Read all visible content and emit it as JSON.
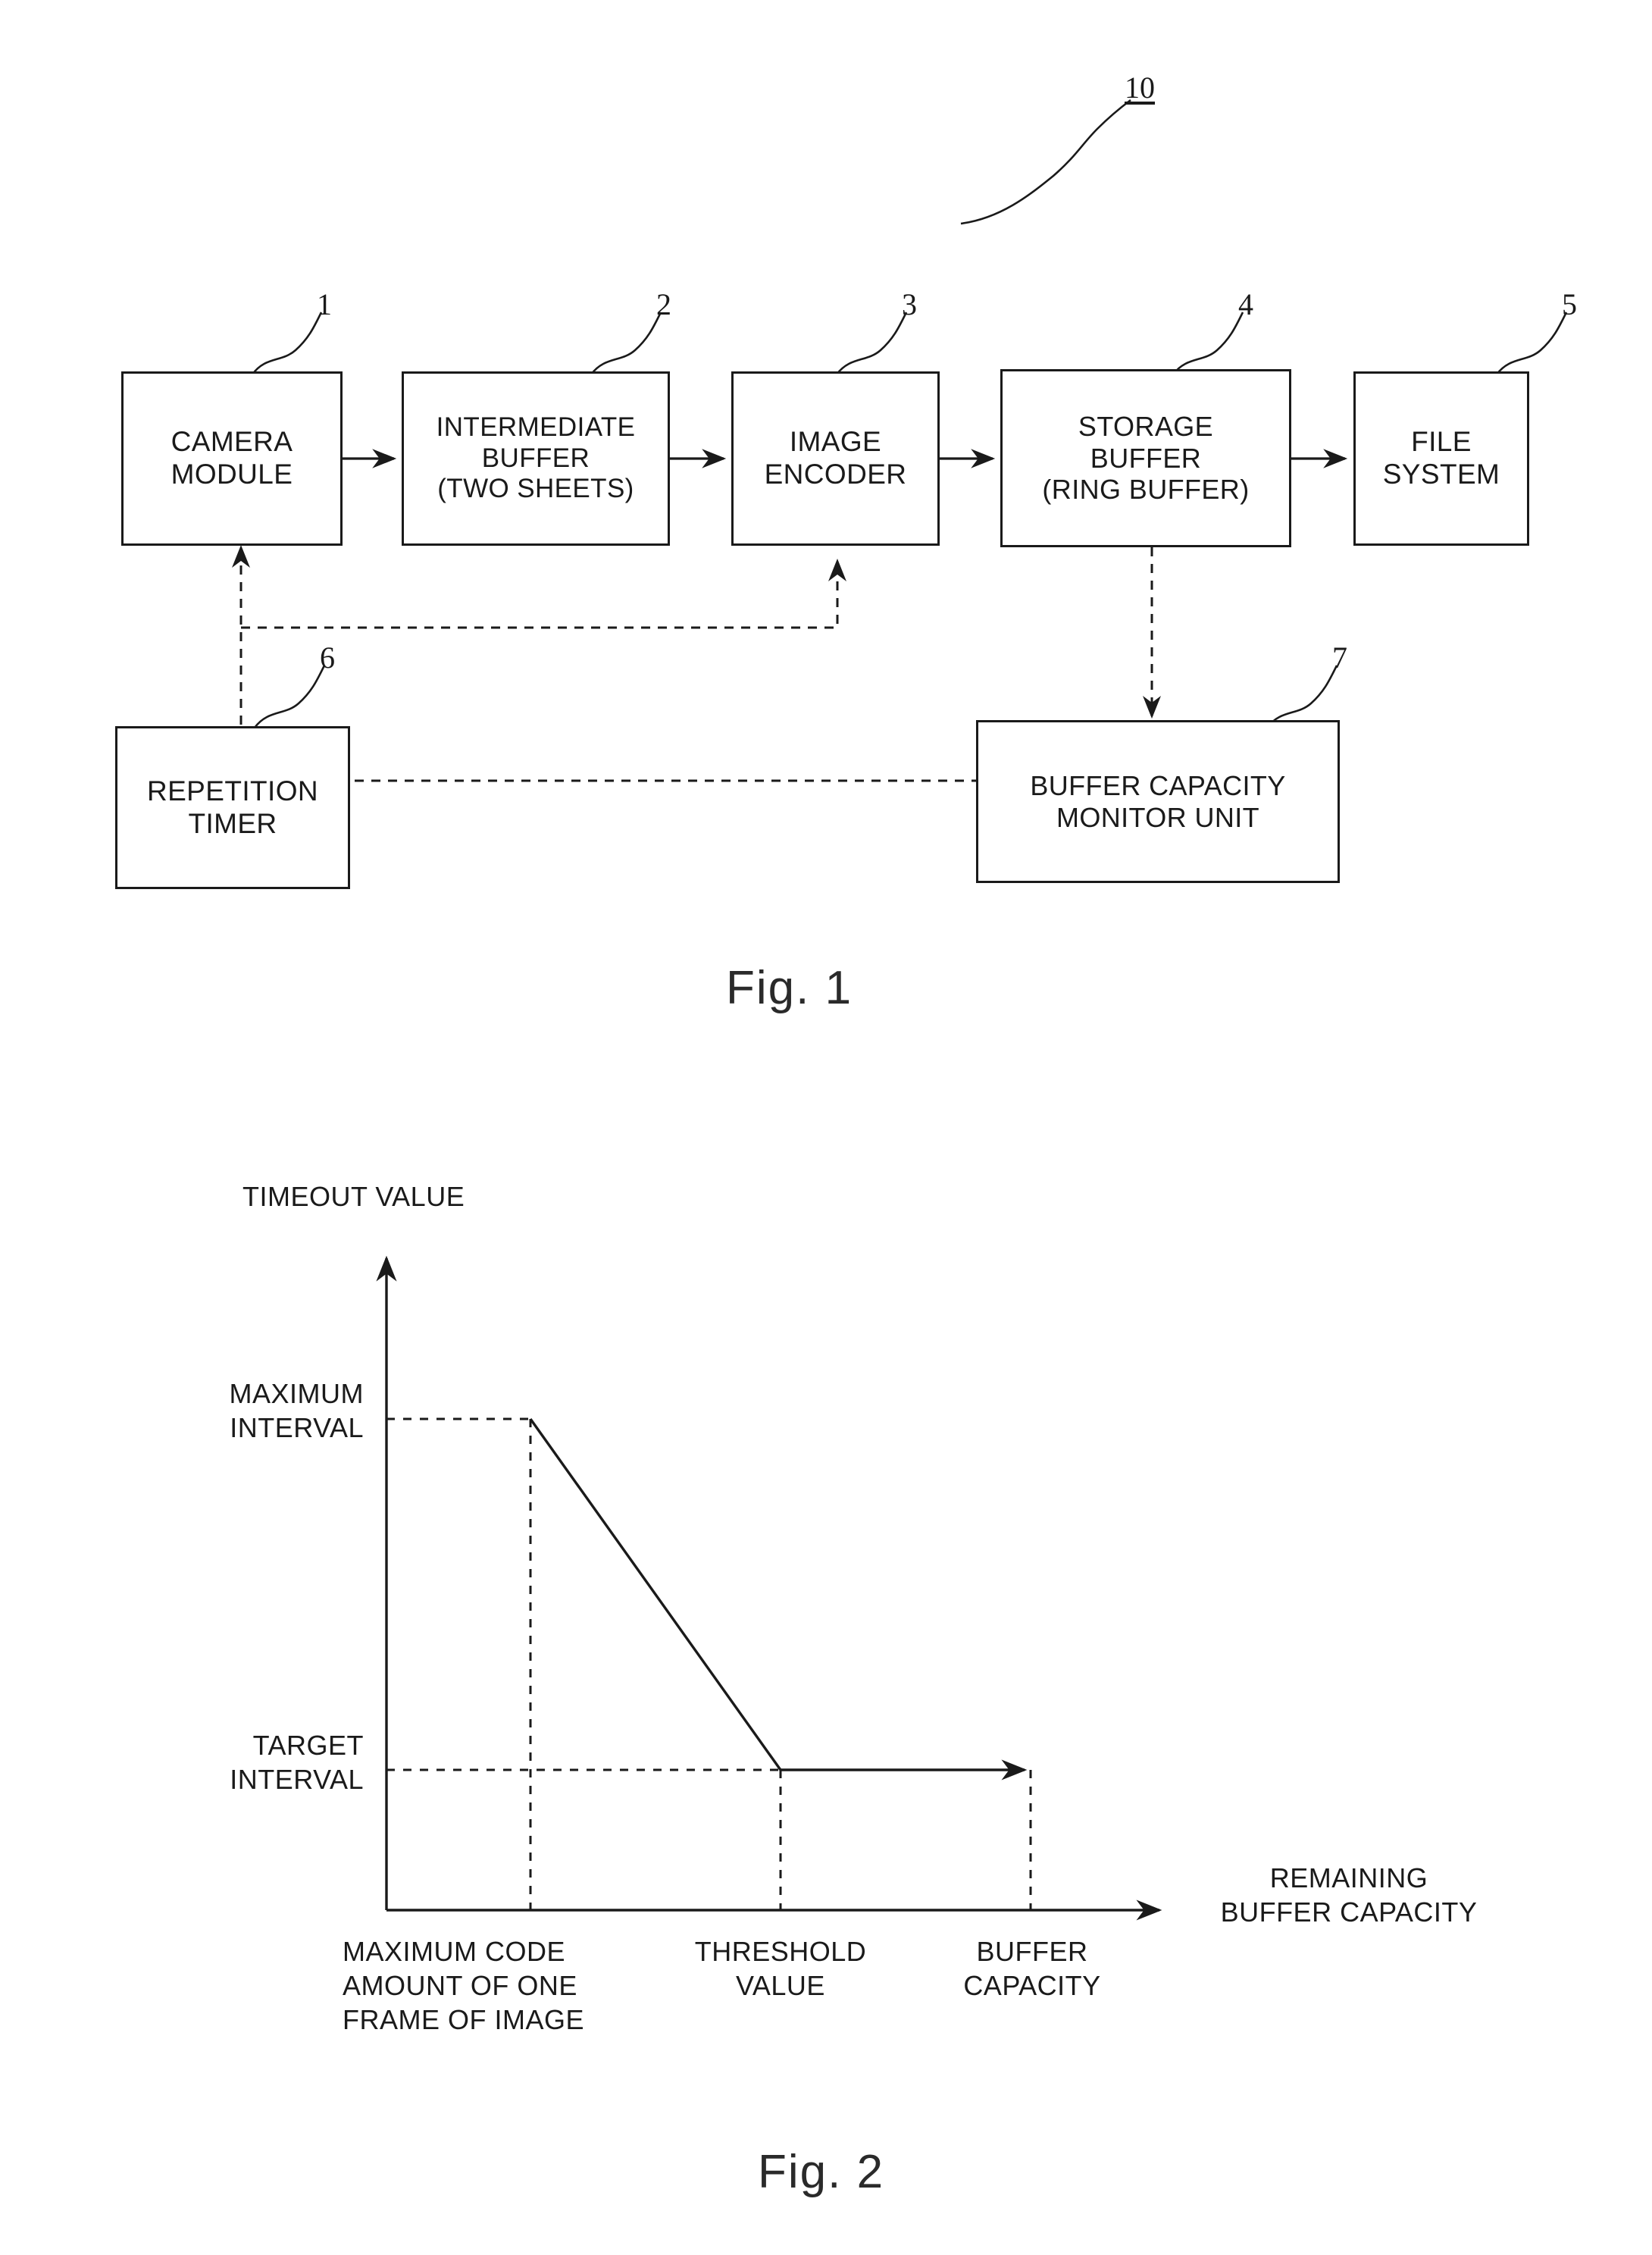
{
  "figure1": {
    "caption": "Fig. 1",
    "system_ref": "10",
    "blocks": [
      {
        "ref": "1",
        "lines": [
          "CAMERA",
          "MODULE"
        ]
      },
      {
        "ref": "2",
        "lines": [
          "INTERMEDIATE",
          "BUFFER",
          "(TWO SHEETS)"
        ]
      },
      {
        "ref": "3",
        "lines": [
          "IMAGE",
          "ENCODER"
        ]
      },
      {
        "ref": "4",
        "lines": [
          "STORAGE",
          "BUFFER",
          "(RING BUFFER)"
        ]
      },
      {
        "ref": "5",
        "lines": [
          "FILE",
          "SYSTEM"
        ]
      },
      {
        "ref": "6",
        "lines": [
          "REPETITION",
          "TIMER"
        ]
      },
      {
        "ref": "7",
        "lines": [
          "BUFFER CAPACITY",
          "MONITOR UNIT"
        ]
      }
    ]
  },
  "figure2": {
    "caption": "Fig. 2",
    "y_axis_title": "TIMEOUT VALUE",
    "x_axis_title_line1": "REMAINING",
    "x_axis_title_line2": "BUFFER CAPACITY",
    "y_tick_max_line1": "MAXIMUM",
    "y_tick_max_line2": "INTERVAL",
    "y_tick_target_line1": "TARGET",
    "y_tick_target_line2": "INTERVAL",
    "x_tick_1_line1": "MAXIMUM CODE",
    "x_tick_1_line2": "AMOUNT OF ONE",
    "x_tick_1_line3": "FRAME OF IMAGE",
    "x_tick_2_line1": "THRESHOLD",
    "x_tick_2_line2": "VALUE",
    "x_tick_3_line1": "BUFFER",
    "x_tick_3_line2": "CAPACITY"
  },
  "chart_data": {
    "type": "line",
    "title": "",
    "xlabel": "REMAINING BUFFER CAPACITY",
    "ylabel": "TIMEOUT VALUE",
    "x_ticks": [
      "MAXIMUM CODE AMOUNT OF ONE FRAME OF IMAGE",
      "THRESHOLD VALUE",
      "BUFFER CAPACITY"
    ],
    "y_ticks": [
      "TARGET INTERVAL",
      "MAXIMUM INTERVAL"
    ],
    "series": [
      {
        "name": "timeout value",
        "points": [
          {
            "x": "MAXIMUM CODE AMOUNT OF ONE FRAME OF IMAGE",
            "y": "MAXIMUM INTERVAL"
          },
          {
            "x": "THRESHOLD VALUE",
            "y": "TARGET INTERVAL"
          },
          {
            "x": "BUFFER CAPACITY",
            "y": "TARGET INTERVAL"
          }
        ]
      }
    ],
    "grid": false,
    "legend": "none",
    "notes": "Timeout value decreases linearly from MAXIMUM INTERVAL at the maximum-code-amount point down to TARGET INTERVAL at the threshold value, then stays flat at TARGET INTERVAL up to the full buffer capacity."
  },
  "colors": {
    "ink": "#1a1a1a",
    "paper": "#ffffff"
  }
}
